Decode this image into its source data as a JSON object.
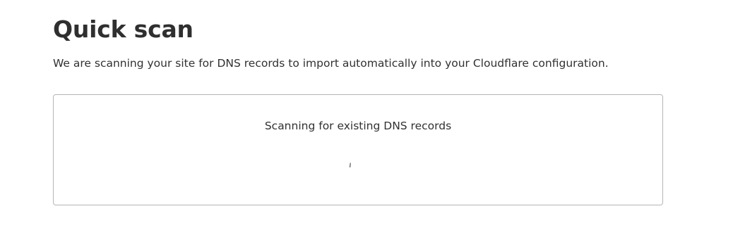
{
  "header": {
    "title": "Quick scan",
    "description": "We are scanning your site for DNS records to import automatically into your Cloudflare configuration."
  },
  "scan_panel": {
    "status_text": "Scanning for existing DNS records",
    "spinner_icon": "loading-spinner-icon"
  },
  "colors": {
    "text": "#313131",
    "border": "#b5b5b5",
    "spinner": "#888888"
  }
}
